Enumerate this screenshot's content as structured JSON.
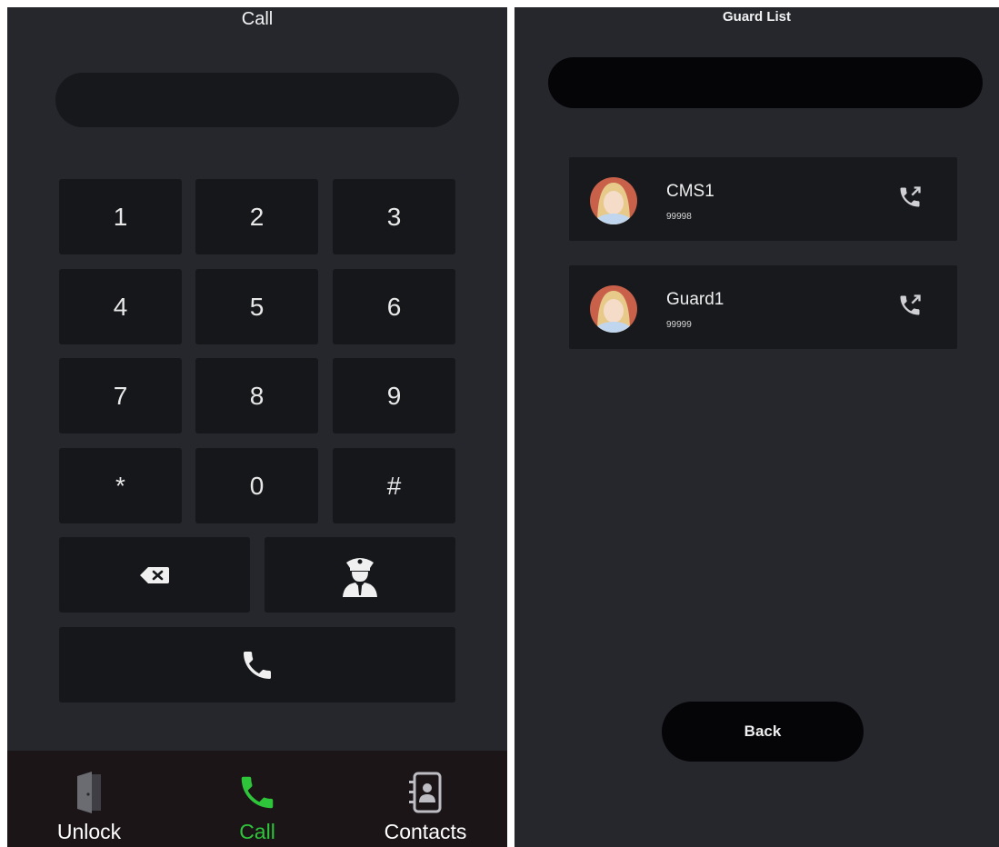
{
  "call_screen": {
    "title": "Call",
    "keypad": [
      "1",
      "2",
      "3",
      "4",
      "5",
      "6",
      "7",
      "8",
      "9",
      "*",
      "0",
      "#"
    ],
    "icons": {
      "backspace": "backspace-icon",
      "guard": "guard-icon",
      "call": "phone-icon"
    },
    "nav": [
      {
        "label": "Unlock",
        "icon": "door-icon",
        "active": false
      },
      {
        "label": "Call",
        "icon": "phone-icon",
        "active": true
      },
      {
        "label": "Contacts",
        "icon": "contacts-book-icon",
        "active": false
      }
    ]
  },
  "guard_list": {
    "title": "Guard List",
    "contacts": [
      {
        "name": "CMS1",
        "number": "99998",
        "icon": "call-out-icon"
      },
      {
        "name": "Guard1",
        "number": "99999",
        "icon": "call-out-icon"
      }
    ],
    "back_label": "Back"
  },
  "colors": {
    "background": "#25272d",
    "key": "#15171a",
    "accent_green": "#2ec53a",
    "nav_background": "#1c1518"
  }
}
